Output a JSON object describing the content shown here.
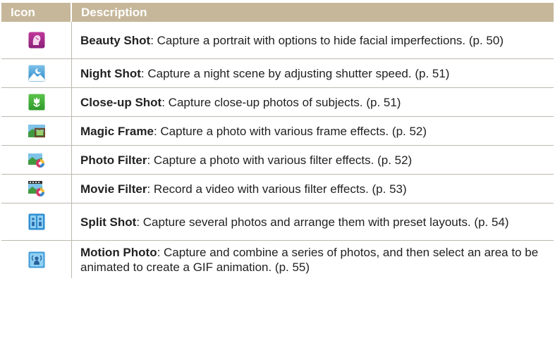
{
  "header": {
    "icon_col": "Icon",
    "desc_col": "Description"
  },
  "rows": [
    {
      "icon": "beauty-shot-icon",
      "title": "Beauty Shot",
      "text": ": Capture a portrait with options to hide facial imperfections. (p. 50)"
    },
    {
      "icon": "night-shot-icon",
      "title": "Night Shot",
      "text": ": Capture a night scene by adjusting shutter speed. (p. 51)"
    },
    {
      "icon": "close-up-shot-icon",
      "title": "Close-up Shot",
      "text": ": Capture close-up photos of subjects. (p. 51)"
    },
    {
      "icon": "magic-frame-icon",
      "title": "Magic Frame",
      "text": ": Capture a photo with various frame effects. (p. 52)"
    },
    {
      "icon": "photo-filter-icon",
      "title": "Photo Filter",
      "text": ": Capture a photo with various filter effects. (p. 52)"
    },
    {
      "icon": "movie-filter-icon",
      "title": "Movie Filter",
      "text": ": Record a video with various filter effects. (p. 53)"
    },
    {
      "icon": "split-shot-icon",
      "title": "Split Shot",
      "text": ": Capture several photos and arrange them with preset layouts. (p. 54)"
    },
    {
      "icon": "motion-photo-icon",
      "title": "Motion Photo",
      "text": ": Capture and combine a series of photos, and then select an area to be animated to create a GIF animation. (p. 55)"
    }
  ],
  "colors": {
    "header_bg": "#c6b79a",
    "rule": "#bdb8b0"
  }
}
